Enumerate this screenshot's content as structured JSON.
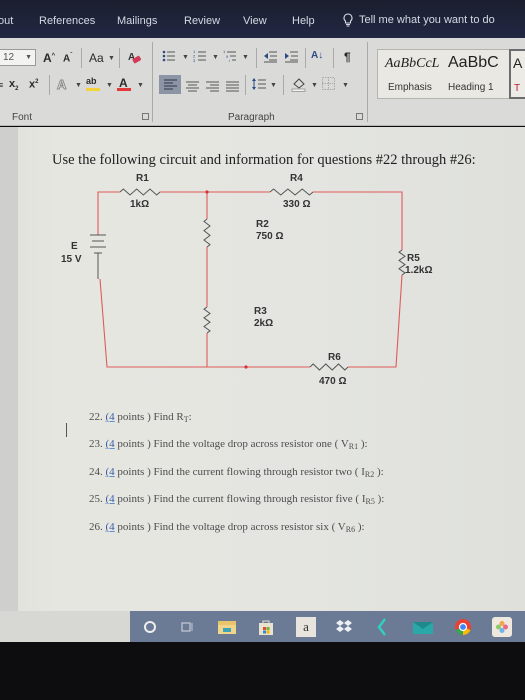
{
  "ribbon_tabs": [
    "out",
    "References",
    "Mailings",
    "Review",
    "View",
    "Help"
  ],
  "tell_me": {
    "icon": "lightbulb-icon",
    "placeholder": "Tell me what you want to do"
  },
  "font_group": {
    "font_size": "12",
    "grow_font": "A",
    "shrink_font": "A",
    "change_case": "Aa",
    "subscript": "x",
    "superscript": "x",
    "text_effects": "A",
    "highlight": "ab",
    "font_color": "A",
    "label": "Font"
  },
  "paragraph_group": {
    "pilcrow": "¶",
    "sort": "A↓",
    "label": "Paragraph"
  },
  "styles": [
    {
      "sample": "AaBbCcL",
      "name": "Emphasis"
    },
    {
      "sample": "AaBbC",
      "name": "Heading 1"
    },
    {
      "sample": "A",
      "name": "T"
    }
  ],
  "document": {
    "heading": "Use the following circuit and information for questions #22 through #26:",
    "circuit": {
      "wire_color": "#e05a5a",
      "source": {
        "name": "E",
        "value": "15 V"
      },
      "resistors": [
        {
          "name": "R1",
          "value": "1kΩ"
        },
        {
          "name": "R2",
          "value": "750 Ω"
        },
        {
          "name": "R3",
          "value": "2kΩ"
        },
        {
          "name": "R4",
          "value": "330 Ω"
        },
        {
          "name": "R5",
          "value": "1.2kΩ"
        },
        {
          "name": "R6",
          "value": "470 Ω"
        }
      ]
    },
    "questions": [
      {
        "num": "22.",
        "points": "(4",
        "rest": " points ) Find R",
        "sub": "T",
        "tail": ":"
      },
      {
        "num": "23.",
        "points": "(4",
        "rest": " points ) Find the voltage drop across resistor one ( V",
        "sub": "R1",
        "tail": " ):"
      },
      {
        "num": "24.",
        "points": "(4",
        "rest": " points ) Find the current flowing through resistor two ( I",
        "sub": "R2",
        "tail": " ):"
      },
      {
        "num": "25.",
        "points": "(4",
        "rest": " points ) Find the current flowing through resistor five ( I",
        "sub": "R5",
        "tail": " ):"
      },
      {
        "num": "26.",
        "points": "(4",
        "rest": " points ) Find the voltage drop across resistor six ( V",
        "sub": "R6",
        "tail": " ):"
      }
    ]
  },
  "taskbar": {
    "items": [
      "cortana-icon",
      "task-view-icon",
      "file-explorer-icon",
      "store-icon",
      "amazon-icon",
      "dropbox-icon",
      "app-icon",
      "mail-icon",
      "chrome-icon",
      "photos-icon"
    ],
    "amazon_letter": "a"
  }
}
